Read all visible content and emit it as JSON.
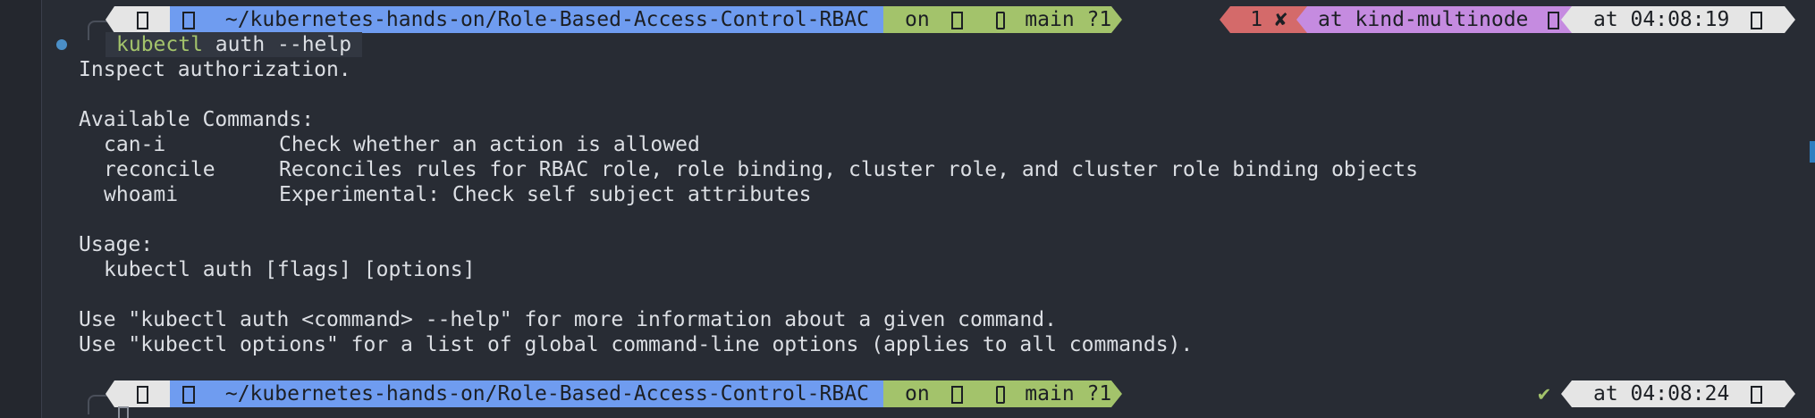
{
  "prompt1": {
    "path": "~/kubernetes-hands-on/Role-Based-Access-Control-RBAC",
    "git_on": "on",
    "git_branch": "main ?1",
    "exit_status": "1 ✘",
    "context": "at kind-multinode",
    "time": "at 04:08:19"
  },
  "command": {
    "executable": "kubectl",
    "args": " auth --help"
  },
  "output": {
    "line_intro": "Inspect authorization.",
    "available_header": "Available Commands:",
    "commands": [
      {
        "name": "can-i",
        "desc": "Check whether an action is allowed"
      },
      {
        "name": "reconcile",
        "desc": "Reconciles rules for RBAC role, role binding, cluster role, and cluster role binding objects"
      },
      {
        "name": "whoami",
        "desc": "Experimental: Check self subject attributes"
      }
    ],
    "usage_header": "Usage:",
    "usage_line": "kubectl auth [flags] [options]",
    "help_line1": "Use \"kubectl auth <command> --help\" for more information about a given command.",
    "help_line2": "Use \"kubectl options\" for a list of global command-line options (applies to all commands)."
  },
  "prompt2": {
    "path": "~/kubernetes-hands-on/Role-Based-Access-Control-RBAC",
    "git_on": "on",
    "git_branch": "main ?1",
    "status_ok": "✔",
    "time": "at 04:08:24"
  },
  "colors": {
    "background": "#282c34",
    "dir_segment": "#6f9cf0",
    "git_segment": "#a3c36b",
    "error_segment": "#d46a6a",
    "context_segment": "#c58be0",
    "time_segment": "#e5e5e5",
    "ok_check": "#a3c36b"
  },
  "icons": {
    "os": "apple-icon",
    "folder": "folder-icon",
    "git": "git-icon",
    "branch": "branch-icon",
    "kube": "kubernetes-icon",
    "clock": "clock-icon"
  }
}
